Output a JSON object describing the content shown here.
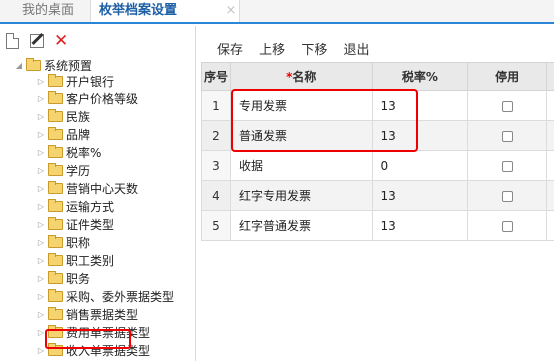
{
  "tabs": [
    {
      "label": "我的桌面",
      "active": false
    },
    {
      "label": "枚举档案设置",
      "active": true,
      "close_icon": "×"
    }
  ],
  "left_toolbar": {
    "icons": [
      "new-document-icon",
      "edit-icon",
      "delete-icon"
    ],
    "delete_glyph": "✕"
  },
  "tree": {
    "root": "系统预置",
    "items": [
      "开户银行",
      "客户价格等级",
      "民族",
      "品牌",
      "税率%",
      "学历",
      "营销中心天数",
      "运输方式",
      "证件类型",
      "职称",
      "职工类别",
      "职务",
      "采购、委外票据类型",
      "销售票据类型",
      "费用单票据类型",
      "收入单票据类型"
    ],
    "highlighted": "销售票据类型"
  },
  "right_toolbar": {
    "save": "保存",
    "move_up": "上移",
    "move_down": "下移",
    "exit": "退出"
  },
  "grid": {
    "headers": {
      "index": "序号",
      "required_mark": "*",
      "name": "名称",
      "tax": "税率%",
      "disabled": "停用"
    },
    "rows": [
      {
        "index": "1",
        "name": "专用发票",
        "tax": "13",
        "disabled": false
      },
      {
        "index": "2",
        "name": "普通发票",
        "tax": "13",
        "disabled": false
      },
      {
        "index": "3",
        "name": "收据",
        "tax": "0",
        "disabled": false
      },
      {
        "index": "4",
        "name": "红字专用发票",
        "tax": "13",
        "disabled": false
      },
      {
        "index": "5",
        "name": "红字普通发票",
        "tax": "13",
        "disabled": false
      }
    ]
  },
  "colors": {
    "accent": "#2b86d8",
    "highlight": "#e00000",
    "folder": "#f5d36e"
  }
}
